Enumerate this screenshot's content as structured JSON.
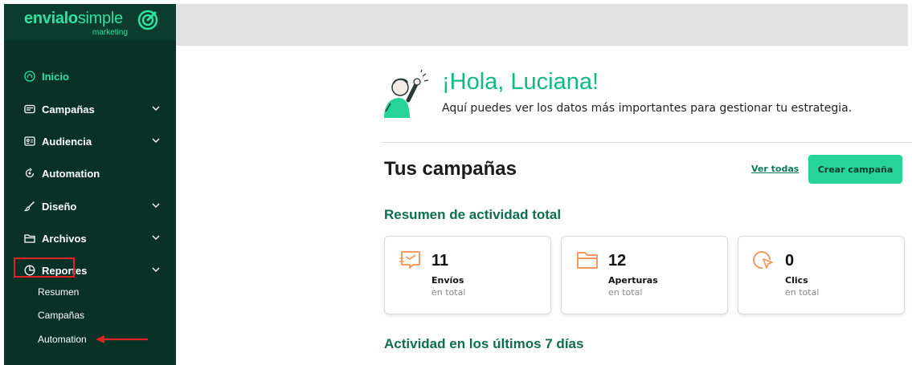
{
  "brand": {
    "name_bold": "envialo",
    "name_light": "simple",
    "tagline": "marketing",
    "logo_icon": "brand-spiral-icon",
    "color": "#2ee3a0"
  },
  "sidebar": {
    "items": [
      {
        "label": "Inicio",
        "icon": "home-icon",
        "active": true
      },
      {
        "label": "Campañas",
        "icon": "mail-icon",
        "expandable": true
      },
      {
        "label": "Audiencia",
        "icon": "contacts-icon",
        "expandable": true
      },
      {
        "label": "Automation",
        "icon": "automation-icon"
      },
      {
        "label": "Diseño",
        "icon": "brush-icon",
        "expandable": true
      },
      {
        "label": "Archivos",
        "icon": "folder-icon",
        "expandable": true
      },
      {
        "label": "Reportes",
        "icon": "chart-pie-icon",
        "expandable": true,
        "expanded": true
      }
    ],
    "subitems": [
      "Resumen",
      "Campañas",
      "Automation"
    ]
  },
  "greeting": {
    "title": "¡Hola, Luciana!",
    "subtitle": "Aquí puedes ver los datos más importantes para gestionar tu estrategia."
  },
  "campaigns": {
    "title": "Tus campañas",
    "view_all": "Ver todas",
    "create_button": "Crear campaña"
  },
  "summary": {
    "title": "Resumen de actividad total",
    "cards": [
      {
        "value": "11",
        "label": "Envíos",
        "sub": "en total",
        "icon": "send-icon"
      },
      {
        "value": "12",
        "label": "Aperturas",
        "sub": "en total",
        "icon": "open-folder-icon"
      },
      {
        "value": "0",
        "label": "Clics",
        "sub": "en total",
        "icon": "click-icon"
      }
    ]
  },
  "activity": {
    "title": "Actividad en los últimos 7 días"
  },
  "colors": {
    "sidebar_bg": "#093126",
    "accent": "#2ee3a0",
    "button": "#26d49a",
    "heading_green": "#0e6e4f",
    "annotation_red": "#e02424"
  }
}
